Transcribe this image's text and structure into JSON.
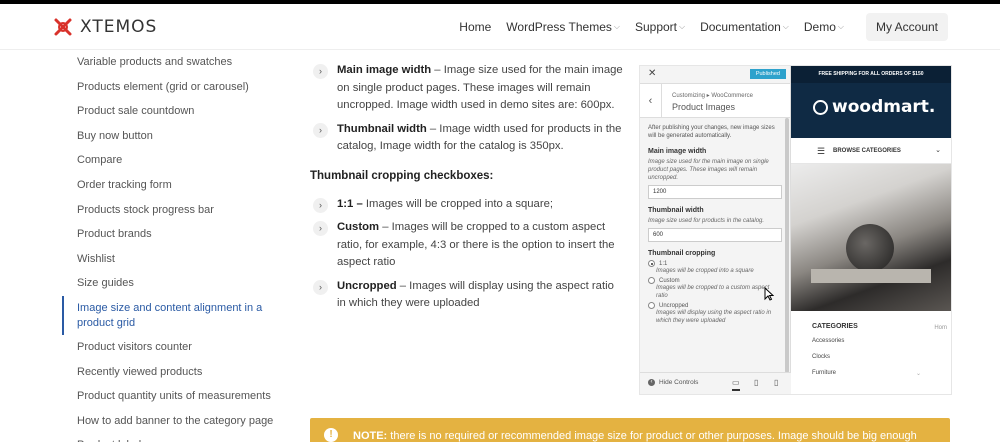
{
  "header": {
    "logo_text": "XTEMOS",
    "nav": [
      {
        "label": "Home",
        "has_dropdown": false
      },
      {
        "label": "WordPress Themes",
        "has_dropdown": true
      },
      {
        "label": "Support",
        "has_dropdown": true
      },
      {
        "label": "Documentation",
        "has_dropdown": true
      },
      {
        "label": "Demo",
        "has_dropdown": true
      }
    ],
    "account_label": "My Account"
  },
  "sidebar": {
    "items": [
      "Variable products and swatches",
      "Products element (grid or carousel)",
      "Product sale countdown",
      "Buy now button",
      "Compare",
      "Order tracking form",
      "Products stock progress bar",
      "Product brands",
      "Wishlist",
      "Size guides",
      "Image size and content alignment in a product grid",
      "Product visitors counter",
      "Recently viewed products",
      "Product quantity units of measurements",
      "How to add banner to the category page",
      "Product labels"
    ],
    "active_index": 10
  },
  "content": {
    "bullets_top": [
      {
        "term": "Main image width",
        "text": " – Image size used for the main image on single product pages. These images will remain uncropped. Image width used in demo sites are: 600px."
      },
      {
        "term": "Thumbnail width",
        "text": " – Image width used for products in the catalog, Image width for the catalog is 350px."
      }
    ],
    "subheading": "Thumbnail cropping checkboxes:",
    "bullets_bottom": [
      {
        "term": "1:1 –",
        "text": " Images will be cropped into a square;"
      },
      {
        "term": "Custom",
        "text": " – Images will be cropped to a custom aspect ratio, for example, 4:3 or there is the option to insert the aspect ratio"
      },
      {
        "term": "Uncropped",
        "text": " – Images will display using the aspect ratio in which they were uploaded"
      }
    ]
  },
  "customizer": {
    "published_label": "Published",
    "breadcrumb": "Customizing ▸ WooCommerce",
    "title": "Product Images",
    "note": "After publishing your changes, new image sizes will be generated automatically.",
    "main_label": "Main image width",
    "main_desc": "Image size used for the main image on single product pages. These images will remain uncropped.",
    "main_value": "1200",
    "thumb_label": "Thumbnail width",
    "thumb_desc": "Image size used for products in the catalog.",
    "thumb_value": "600",
    "crop_label": "Thumbnail cropping",
    "options": [
      {
        "label": "1:1",
        "desc": "Images will be cropped into a square",
        "selected": true
      },
      {
        "label": "Custom",
        "desc": "Images will be cropped to a custom aspect ratio",
        "selected": false
      },
      {
        "label": "Uncropped",
        "desc": "Images will display using the aspect ratio in which they were uploaded",
        "selected": false
      }
    ],
    "hide_controls": "Hide Controls"
  },
  "preview": {
    "strip": "FREE SHIPPING FOR ALL ORDERS OF $150",
    "logo": "woodmart.",
    "browse": "BROWSE CATEGORIES",
    "categories_title": "CATEGORIES",
    "home_link": "Hom",
    "categories": [
      "Accessories",
      "Clocks",
      "Furniture"
    ]
  },
  "note": {
    "label": "NOTE:",
    "text": " there is no required or recommended image size for product or other purposes. Image should be big enough"
  },
  "colors": {
    "accent": "#2a5aa4",
    "note_bg": "#e4b241",
    "woodmart_blue": "#0f2a44",
    "wp_blue": "#2ea2cc"
  }
}
